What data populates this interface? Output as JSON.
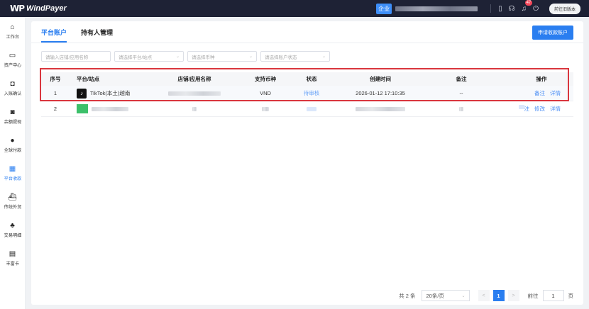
{
  "topbar": {
    "logo_mark": "WP",
    "logo_text": "WindPayer",
    "enterprise_badge": "企业",
    "notification_count": "47",
    "old_version_button": "前往旧版本"
  },
  "sidebar": {
    "items": [
      {
        "label": "工作台",
        "icon": "home-icon",
        "glyph": "⌂"
      },
      {
        "label": "资产中心",
        "icon": "wallet-icon",
        "glyph": "▭"
      },
      {
        "label": "入账确认",
        "icon": "confirm-icon",
        "glyph": "◘"
      },
      {
        "label": "余额提现",
        "icon": "withdraw-icon",
        "glyph": "◙"
      },
      {
        "label": "全球付款",
        "icon": "payment-icon",
        "glyph": "●"
      },
      {
        "label": "平台收款",
        "icon": "store-icon",
        "glyph": "▦"
      },
      {
        "label": "传统外贸",
        "icon": "ship-icon",
        "glyph": "⛴"
      },
      {
        "label": "交易明细",
        "icon": "users-icon",
        "glyph": "♣"
      },
      {
        "label": "丰富卡",
        "icon": "card-icon",
        "glyph": "▤"
      }
    ],
    "active_index": 5
  },
  "tabs": [
    {
      "label": "平台账户"
    },
    {
      "label": "持有人管理"
    }
  ],
  "apply_button": "申请收款账户",
  "filters": {
    "shop_placeholder": "请输入店铺/应用名称",
    "platform_placeholder": "请选择平台/站点",
    "currency_placeholder": "请选择币种",
    "status_placeholder": "请选择账户状态"
  },
  "table": {
    "headers": {
      "index": "序号",
      "platform": "平台/站点",
      "shop": "店铺/应用名称",
      "currency": "支持币种",
      "status": "状态",
      "created": "创建时间",
      "note": "备注",
      "ops": "操作"
    },
    "rows": [
      {
        "index": "1",
        "platform": "TikTok(本土)越南",
        "currency": "VND",
        "status": "待审核",
        "created": "2026-01-12 17:10:35",
        "note": "--",
        "op1": "备注",
        "op2": "详情"
      },
      {
        "index": "2",
        "op0": "注",
        "op1": "修改",
        "op2": "详情"
      }
    ]
  },
  "pagination": {
    "total": "共 2 条",
    "page_size": "20条/页",
    "prev": "<",
    "current": "1",
    "next": ">",
    "goto_label": "前往",
    "goto_value": "1",
    "page_unit": "页"
  },
  "colors": {
    "primary": "#2a7ef0",
    "topbar": "#1e2235",
    "highlight_border": "#d9363e"
  }
}
